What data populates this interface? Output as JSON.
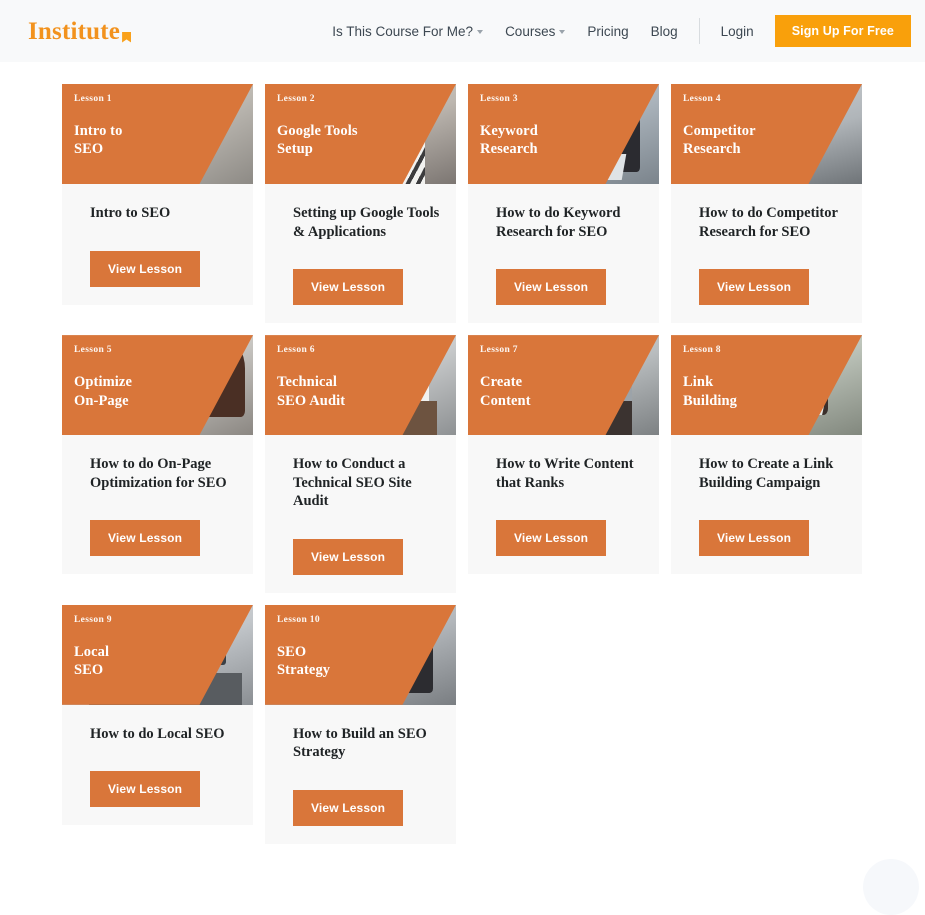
{
  "header": {
    "logo_text": "Institute",
    "nav": [
      {
        "label": "Is This Course For Me?",
        "has_caret": true,
        "name": "nav-is-this-course-for-me"
      },
      {
        "label": "Courses",
        "has_caret": true,
        "name": "nav-courses"
      },
      {
        "label": "Pricing",
        "has_caret": false,
        "name": "nav-pricing"
      },
      {
        "label": "Blog",
        "has_caret": false,
        "name": "nav-blog"
      }
    ],
    "login_label": "Login",
    "signup_label": "Sign Up For Free",
    "accent_orange": "#f9a00b",
    "bg": "#f8f9fa"
  },
  "cards": [
    {
      "lesson": "Lesson 1",
      "banner_title": "Intro to\nSEO",
      "title": "Intro to SEO",
      "cta": "View Lesson",
      "photo": "p1"
    },
    {
      "lesson": "Lesson 2",
      "banner_title": "Google Tools\nSetup",
      "title": "Setting up Google Tools & Applications",
      "cta": "View Lesson",
      "photo": "p2"
    },
    {
      "lesson": "Lesson 3",
      "banner_title": "Keyword\nResearch",
      "title": "How to do Keyword Research for SEO",
      "cta": "View Lesson",
      "photo": "p3"
    },
    {
      "lesson": "Lesson 4",
      "banner_title": "Competitor\nResearch",
      "title": "How to do Competitor Research for SEO",
      "cta": "View Lesson",
      "photo": "p4"
    },
    {
      "lesson": "Lesson 5",
      "banner_title": "Optimize\nOn-Page",
      "title": "How to do On-Page Optimization for SEO",
      "cta": "View Lesson",
      "photo": "p5"
    },
    {
      "lesson": "Lesson 6",
      "banner_title": "Technical\nSEO Audit",
      "title": "How to Conduct a Technical SEO Site Audit",
      "cta": "View Lesson",
      "photo": "p6"
    },
    {
      "lesson": "Lesson 7",
      "banner_title": "Create\nContent",
      "title": "How to Write Content that Ranks",
      "cta": "View Lesson",
      "photo": "p7"
    },
    {
      "lesson": "Lesson 8",
      "banner_title": "Link\nBuilding",
      "title": "How to Create a Link Building Campaign",
      "cta": "View Lesson",
      "photo": "p8"
    },
    {
      "lesson": "Lesson 9",
      "banner_title": "Local\nSEO",
      "title": "How to do Local SEO",
      "cta": "View Lesson",
      "photo": "p9"
    },
    {
      "lesson": "Lesson 10",
      "banner_title": "SEO\nStrategy",
      "title": "How to Build an SEO Strategy",
      "cta": "View Lesson",
      "photo": "p10"
    }
  ],
  "theme": {
    "card_orange": "#d9763a",
    "card_bg": "#f8f8f8",
    "page_bg": "#ffffff",
    "text_dark": "#1f2325"
  }
}
